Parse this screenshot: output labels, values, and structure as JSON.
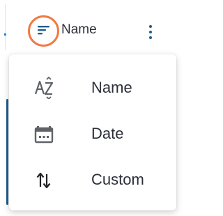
{
  "toolbar": {
    "sort_icon": "sort-lines-icon",
    "sort_label": "Name",
    "more_icon": "more-vertical-icon",
    "accent_color": "#f07a45"
  },
  "menu": {
    "items": [
      {
        "label": "Name",
        "icon": "sort-alpha-icon"
      },
      {
        "label": "Date",
        "icon": "calendar-icon"
      },
      {
        "label": "Custom",
        "icon": "swap-vert-icon"
      }
    ]
  }
}
